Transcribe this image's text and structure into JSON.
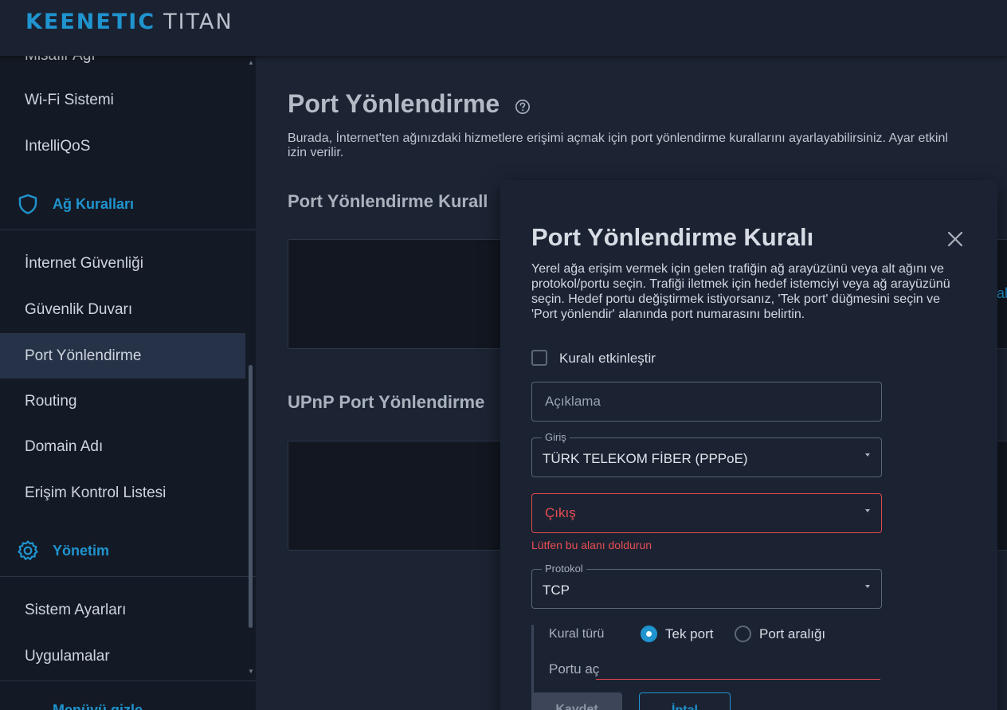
{
  "header": {
    "brand": "KEENETIC",
    "model": "TITAN"
  },
  "sidebar": {
    "partial_top_item": "Misafir Ağı",
    "items_top": [
      {
        "label": "Wi-Fi Sistemi"
      },
      {
        "label": "IntelliQoS"
      }
    ],
    "section_network": {
      "label": "Ağ Kuralları",
      "icon": "shield-icon"
    },
    "items_network": [
      {
        "label": "İnternet Güvenliği"
      },
      {
        "label": "Güvenlik Duvarı"
      },
      {
        "label": "Port Yönlendirme",
        "active": true
      },
      {
        "label": "Routing"
      },
      {
        "label": "Domain Adı"
      },
      {
        "label": "Erişim Kontrol Listesi"
      }
    ],
    "section_admin": {
      "label": "Yönetim",
      "icon": "gear-icon"
    },
    "items_admin": [
      {
        "label": "Sistem Ayarları"
      },
      {
        "label": "Uygulamalar"
      }
    ],
    "bottom_partial": "Menüyü gizle"
  },
  "main": {
    "title": "Port Yönlendirme",
    "description_line1": "Burada, İnternet'ten ağınızdaki hizmetlere erişimi açmak için port yönlendirme kurallarını ayarlayabilirsiniz. Ayar etkinl",
    "description_line2": "izin verilir.",
    "section1_title": "Port Yönlendirme Kurall",
    "section2_title": "UPnP Port Yönlendirme",
    "bg_link_partial": "al"
  },
  "modal": {
    "title": "Port Yönlendirme Kuralı",
    "description": "Yerel ağa erişim vermek için gelen trafiğin ağ arayüzünü veya alt ağını ve protokol/portu seçin. Trafiği iletmek için hedef istemciyi veya ağ arayüzünü seçin. Hedef portu değiştirmek istiyorsanız, 'Tek port' düğmesini seçin ve 'Port yönlendir' alanında port numarasını belirtin.",
    "enable_label": "Kuralı etkinleştir",
    "enable_checked": false,
    "description_field": {
      "placeholder": "Açıklama",
      "value": ""
    },
    "input_field": {
      "legend": "Giriş",
      "value": "TÜRK TELEKOM FİBER (PPPoE)"
    },
    "output_field": {
      "placeholder": "Çıkış",
      "error": "Lütfen bu alanı doldurun"
    },
    "protocol_field": {
      "legend": "Protokol",
      "value": "TCP"
    },
    "rule_type": {
      "label": "Kural türü",
      "options": [
        {
          "label": "Tek port",
          "checked": true
        },
        {
          "label": "Port aralığı",
          "checked": false
        }
      ]
    },
    "open_port_label": "Portu aç",
    "save_label": "Kaydet",
    "cancel_label": "İptal"
  },
  "colors": {
    "accent": "#1f94cf",
    "error": "#e94d52",
    "background": "#1c2434",
    "sidebar": "#141a25"
  }
}
